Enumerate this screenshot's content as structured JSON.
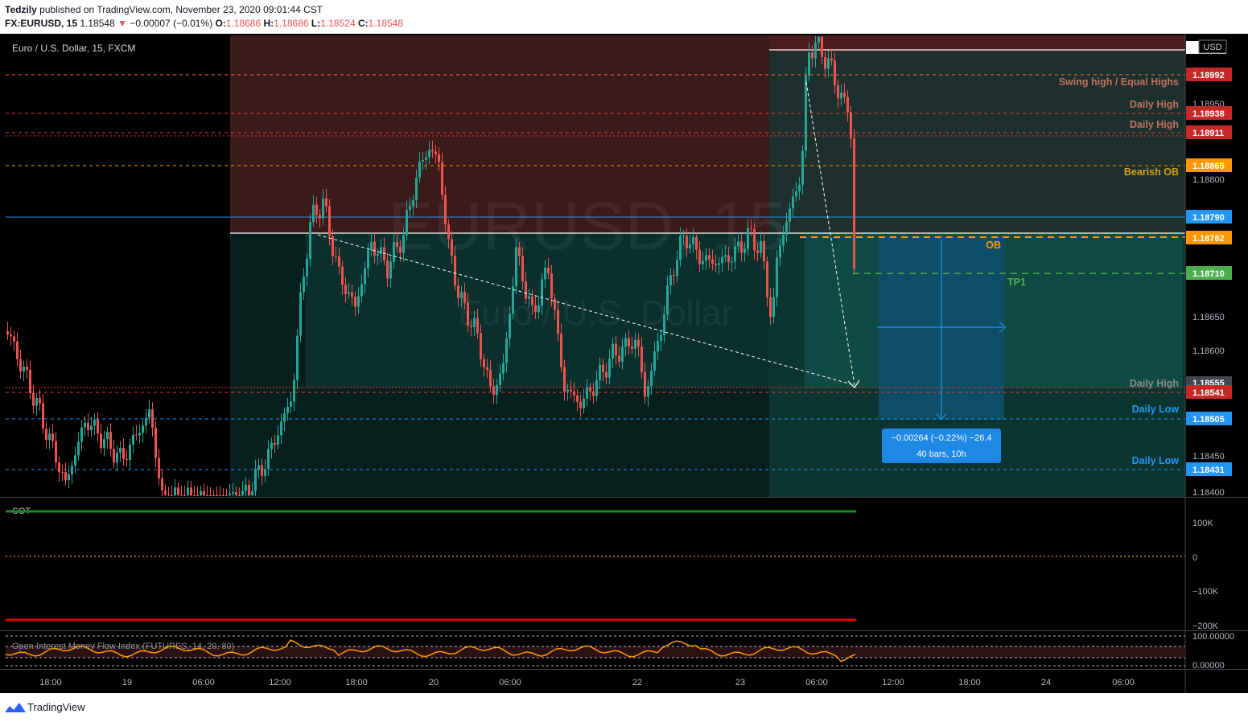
{
  "header": {
    "author": "Tedzily",
    "published_text": "published on TradingView.com, November 23, 2020 09:01:44 CST",
    "symbol": "FX:EURUSD, 15",
    "price": "1.18548",
    "change": "−0.00007 (−0.01%)",
    "o_label": "O:",
    "o_value": "1.18686",
    "h_label": "H:",
    "h_value": "1.18686",
    "l_label": "L:",
    "l_value": "1.18524",
    "c_label": "C:",
    "c_value": "1.18548"
  },
  "chart": {
    "legend": "Euro / U.S. Dollar, 15, FXCM",
    "watermark_symbol": "EURUSD, 15",
    "watermark_name": "Euro / U.S. Dollar",
    "currency_button": "USD",
    "price_ticks": [
      "1.18950",
      "1.18800",
      "1.18650",
      "1.18600",
      "1.18450",
      "1.18400"
    ],
    "level_labels": {
      "swing_high": "Swing high / Equal Highs",
      "daily_high_1": "Daily High",
      "daily_high_2": "Daily High",
      "bearish_ob": "Bearish OB",
      "ob": "OB",
      "tp1": "TP1",
      "daily_high_3": "Daily High",
      "daily_low_1": "Daily Low",
      "daily_low_2": "Daily Low"
    },
    "price_tags": {
      "p1": "1.18992",
      "p2": "1.18938",
      "p3": "1.18911",
      "p4": "1.18865",
      "p5": "1.18790",
      "p6": "1.18762",
      "p7": "1.18710",
      "p8": "1.18555",
      "p9": "1.18541",
      "p10": "1.18505",
      "p11": "1.18431"
    },
    "measure": {
      "line1": "−0.00264 (−0.22%) −26.4",
      "line2": "40 bars, 10h"
    }
  },
  "cot": {
    "title": "COT",
    "ticks": [
      "100K",
      "0",
      "−100K",
      "−200K"
    ]
  },
  "oimfi": {
    "title": "Open Interest Money Flow Index (FUTURES, 14, 20, 80)",
    "ticks": [
      "100.00000",
      "0.00000"
    ]
  },
  "time_axis": [
    "18:00",
    "19",
    "06:00",
    "12:00",
    "18:00",
    "20",
    "06:00",
    "22",
    "23",
    "06:00",
    "12:00",
    "18:00",
    "24",
    "06:00"
  ],
  "footer": {
    "brand": "TradingView"
  },
  "colors": {
    "up": "#26a69a",
    "down": "#ef5350",
    "zone_red": "#3b1a1a",
    "zone_teal": "#0f3a36",
    "orange": "#ff9800",
    "green": "#4caf50",
    "blue": "#2196f3",
    "red_tag": "#c62828"
  }
}
